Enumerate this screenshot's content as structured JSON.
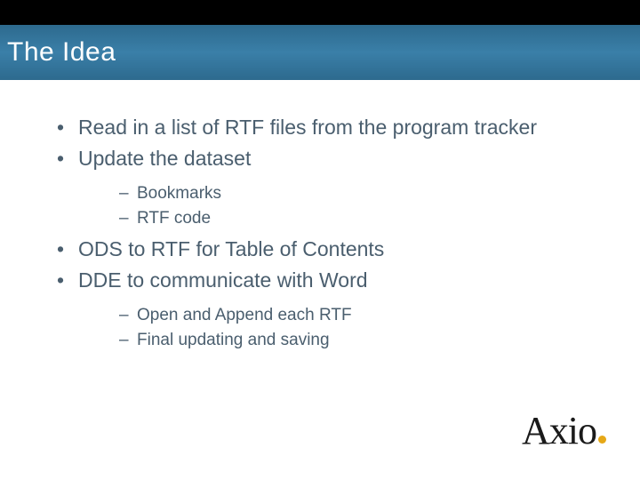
{
  "title": "The Idea",
  "bullets": [
    {
      "text": "Read in a list of RTF files from the program tracker",
      "sub": []
    },
    {
      "text": "Update the dataset",
      "sub": [
        "Bookmarks",
        "RTF code"
      ]
    },
    {
      "text": "ODS to RTF for Table of Contents",
      "sub": []
    },
    {
      "text": "DDE to communicate with Word",
      "sub": [
        "Open and Append each RTF",
        "Final updating and saving"
      ]
    }
  ],
  "logo": {
    "text": "Axio"
  }
}
